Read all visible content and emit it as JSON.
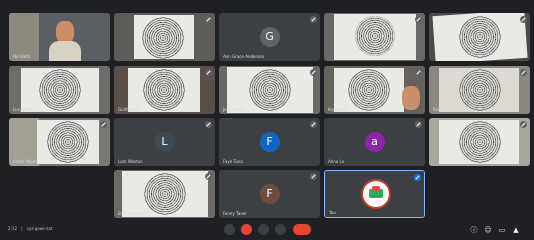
{
  "meeting": {
    "time": "2:12",
    "code": "syz-gxwn-txt"
  },
  "tiles": [
    {
      "id": "t1",
      "name": "Na Halta",
      "type": "person"
    },
    {
      "id": "t2",
      "name": "",
      "type": "mandala"
    },
    {
      "id": "t3",
      "name": "Ann Grace Anderson",
      "type": "avatar",
      "letter": "G",
      "color": "#5f6368"
    },
    {
      "id": "t4",
      "name": "",
      "type": "mandala"
    },
    {
      "id": "t5",
      "name": "",
      "type": "mandala"
    },
    {
      "id": "t6",
      "name": "Lucy Mun",
      "type": "mandala"
    },
    {
      "id": "t7",
      "name": "Guilty Klein",
      "type": "mandala"
    },
    {
      "id": "t8",
      "name": "Joey Wang",
      "type": "mandala"
    },
    {
      "id": "t9",
      "name": "Kaye Bell",
      "type": "mandala"
    },
    {
      "id": "t10",
      "name": "Rom Bell",
      "type": "mandala"
    },
    {
      "id": "t11",
      "name": "Kiddo Paper",
      "type": "mandala"
    },
    {
      "id": "t12",
      "name": "Lam Weston",
      "type": "avatar",
      "letter": "L",
      "color": "#3c4a55"
    },
    {
      "id": "t13",
      "name": "Faye Tuna",
      "type": "avatar",
      "letter": "F",
      "color": "#1565c0"
    },
    {
      "id": "t14",
      "name": "Anna Lo",
      "type": "avatar",
      "letter": "a",
      "color": "#8e24aa"
    },
    {
      "id": "t15",
      "name": "",
      "type": "mandala"
    },
    {
      "id": "t16",
      "name": "Emma Bernisso",
      "type": "mandala"
    },
    {
      "id": "t17",
      "name": "Fanny Taner",
      "type": "avatar",
      "letter": "F",
      "color": "#6d4c41"
    },
    {
      "id": "t18",
      "name": "You",
      "type": "logo"
    }
  ],
  "controls": [
    "mic-button",
    "camera-button",
    "captions-button",
    "raise-hand-button",
    "present-button",
    "leave-call-button"
  ],
  "right_tools": [
    "info-icon",
    "people-icon",
    "chat-icon",
    "activities-icon"
  ]
}
